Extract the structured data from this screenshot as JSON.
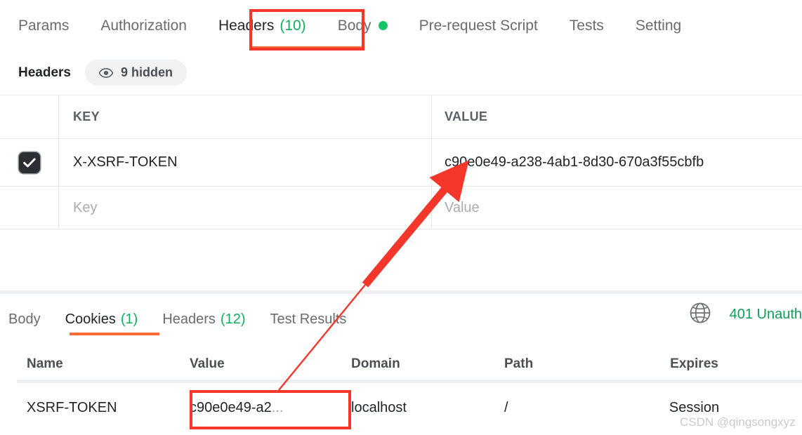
{
  "request_tabs": [
    {
      "label": "Params",
      "count": null,
      "active": false,
      "dot": false
    },
    {
      "label": "Authorization",
      "count": null,
      "active": false,
      "dot": false
    },
    {
      "label": "Headers",
      "count": "(10)",
      "active": true,
      "dot": false
    },
    {
      "label": "Body",
      "count": null,
      "active": false,
      "dot": true
    },
    {
      "label": "Pre-request Script",
      "count": null,
      "active": false,
      "dot": false
    },
    {
      "label": "Tests",
      "count": null,
      "active": false,
      "dot": false
    },
    {
      "label": "Setting",
      "count": null,
      "active": false,
      "dot": false
    }
  ],
  "headers_subbar": {
    "title": "Headers",
    "hidden_label": "9 hidden",
    "eye_icon": "eye-icon"
  },
  "headers_table": {
    "columns": [
      "KEY",
      "VALUE"
    ],
    "rows": [
      {
        "checked": true,
        "key": "X-XSRF-TOKEN",
        "value": "c90e0e49-a238-4ab1-8d30-670a3f55cbfb"
      }
    ],
    "placeholder_row": {
      "key_placeholder": "Key",
      "value_placeholder": "Value"
    }
  },
  "response_tabs": [
    {
      "label": "Body",
      "count": null,
      "active": false
    },
    {
      "label": "Cookies",
      "count": "(1)",
      "active": true
    },
    {
      "label": "Headers",
      "count": "(12)",
      "active": false
    },
    {
      "label": "Test Results",
      "count": null,
      "active": false
    }
  ],
  "response_status": {
    "globe_icon": "globe-icon",
    "status_text": "401 Unauth"
  },
  "cookies_table": {
    "columns": [
      "Name",
      "Value",
      "Domain",
      "Path",
      "Expires"
    ],
    "rows": [
      {
        "name": "XSRF-TOKEN",
        "value": "c90e0e49-a2",
        "value_ellipsis": "...",
        "domain": "localhost",
        "path": "/",
        "expires": "Session"
      }
    ]
  },
  "annotations": {
    "color": "#f5372b",
    "highlight_tab": "Headers (10)",
    "highlight_cookie_value": "c90e0e49-a2...",
    "arrow_from": "cookie value cell",
    "arrow_to": "header value cell"
  },
  "watermark": {
    "text": "CSDN @qingsongxyz"
  },
  "theme": {
    "accent_orange": "#ff6c37",
    "green": "#0fb05d",
    "annotation_red": "#f5372b",
    "status_green": "#0f9d58"
  }
}
